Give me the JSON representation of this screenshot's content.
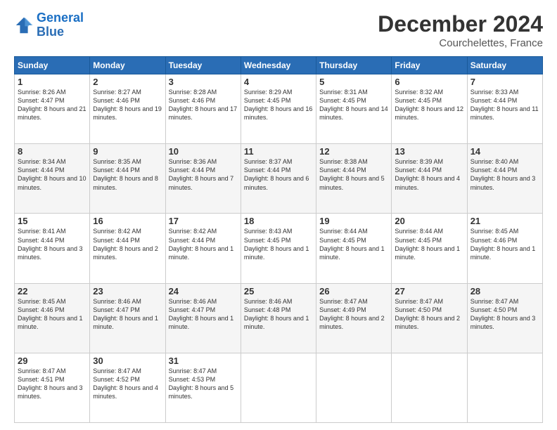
{
  "header": {
    "logo_line1": "General",
    "logo_line2": "Blue",
    "main_title": "December 2024",
    "subtitle": "Courchelettes, France"
  },
  "days_of_week": [
    "Sunday",
    "Monday",
    "Tuesday",
    "Wednesday",
    "Thursday",
    "Friday",
    "Saturday"
  ],
  "weeks": [
    [
      {
        "day": "1",
        "text": "Sunrise: 8:26 AM\nSunset: 4:47 PM\nDaylight: 8 hours and 21 minutes."
      },
      {
        "day": "2",
        "text": "Sunrise: 8:27 AM\nSunset: 4:46 PM\nDaylight: 8 hours and 19 minutes."
      },
      {
        "day": "3",
        "text": "Sunrise: 8:28 AM\nSunset: 4:46 PM\nDaylight: 8 hours and 17 minutes."
      },
      {
        "day": "4",
        "text": "Sunrise: 8:29 AM\nSunset: 4:45 PM\nDaylight: 8 hours and 16 minutes."
      },
      {
        "day": "5",
        "text": "Sunrise: 8:31 AM\nSunset: 4:45 PM\nDaylight: 8 hours and 14 minutes."
      },
      {
        "day": "6",
        "text": "Sunrise: 8:32 AM\nSunset: 4:45 PM\nDaylight: 8 hours and 12 minutes."
      },
      {
        "day": "7",
        "text": "Sunrise: 8:33 AM\nSunset: 4:44 PM\nDaylight: 8 hours and 11 minutes."
      }
    ],
    [
      {
        "day": "8",
        "text": "Sunrise: 8:34 AM\nSunset: 4:44 PM\nDaylight: 8 hours and 10 minutes."
      },
      {
        "day": "9",
        "text": "Sunrise: 8:35 AM\nSunset: 4:44 PM\nDaylight: 8 hours and 8 minutes."
      },
      {
        "day": "10",
        "text": "Sunrise: 8:36 AM\nSunset: 4:44 PM\nDaylight: 8 hours and 7 minutes."
      },
      {
        "day": "11",
        "text": "Sunrise: 8:37 AM\nSunset: 4:44 PM\nDaylight: 8 hours and 6 minutes."
      },
      {
        "day": "12",
        "text": "Sunrise: 8:38 AM\nSunset: 4:44 PM\nDaylight: 8 hours and 5 minutes."
      },
      {
        "day": "13",
        "text": "Sunrise: 8:39 AM\nSunset: 4:44 PM\nDaylight: 8 hours and 4 minutes."
      },
      {
        "day": "14",
        "text": "Sunrise: 8:40 AM\nSunset: 4:44 PM\nDaylight: 8 hours and 3 minutes."
      }
    ],
    [
      {
        "day": "15",
        "text": "Sunrise: 8:41 AM\nSunset: 4:44 PM\nDaylight: 8 hours and 3 minutes."
      },
      {
        "day": "16",
        "text": "Sunrise: 8:42 AM\nSunset: 4:44 PM\nDaylight: 8 hours and 2 minutes."
      },
      {
        "day": "17",
        "text": "Sunrise: 8:42 AM\nSunset: 4:44 PM\nDaylight: 8 hours and 1 minute."
      },
      {
        "day": "18",
        "text": "Sunrise: 8:43 AM\nSunset: 4:45 PM\nDaylight: 8 hours and 1 minute."
      },
      {
        "day": "19",
        "text": "Sunrise: 8:44 AM\nSunset: 4:45 PM\nDaylight: 8 hours and 1 minute."
      },
      {
        "day": "20",
        "text": "Sunrise: 8:44 AM\nSunset: 4:45 PM\nDaylight: 8 hours and 1 minute."
      },
      {
        "day": "21",
        "text": "Sunrise: 8:45 AM\nSunset: 4:46 PM\nDaylight: 8 hours and 1 minute."
      }
    ],
    [
      {
        "day": "22",
        "text": "Sunrise: 8:45 AM\nSunset: 4:46 PM\nDaylight: 8 hours and 1 minute."
      },
      {
        "day": "23",
        "text": "Sunrise: 8:46 AM\nSunset: 4:47 PM\nDaylight: 8 hours and 1 minute."
      },
      {
        "day": "24",
        "text": "Sunrise: 8:46 AM\nSunset: 4:47 PM\nDaylight: 8 hours and 1 minute."
      },
      {
        "day": "25",
        "text": "Sunrise: 8:46 AM\nSunset: 4:48 PM\nDaylight: 8 hours and 1 minute."
      },
      {
        "day": "26",
        "text": "Sunrise: 8:47 AM\nSunset: 4:49 PM\nDaylight: 8 hours and 2 minutes."
      },
      {
        "day": "27",
        "text": "Sunrise: 8:47 AM\nSunset: 4:50 PM\nDaylight: 8 hours and 2 minutes."
      },
      {
        "day": "28",
        "text": "Sunrise: 8:47 AM\nSunset: 4:50 PM\nDaylight: 8 hours and 3 minutes."
      }
    ],
    [
      {
        "day": "29",
        "text": "Sunrise: 8:47 AM\nSunset: 4:51 PM\nDaylight: 8 hours and 3 minutes."
      },
      {
        "day": "30",
        "text": "Sunrise: 8:47 AM\nSunset: 4:52 PM\nDaylight: 8 hours and 4 minutes."
      },
      {
        "day": "31",
        "text": "Sunrise: 8:47 AM\nSunset: 4:53 PM\nDaylight: 8 hours and 5 minutes."
      },
      {
        "day": "",
        "text": ""
      },
      {
        "day": "",
        "text": ""
      },
      {
        "day": "",
        "text": ""
      },
      {
        "day": "",
        "text": ""
      }
    ]
  ]
}
